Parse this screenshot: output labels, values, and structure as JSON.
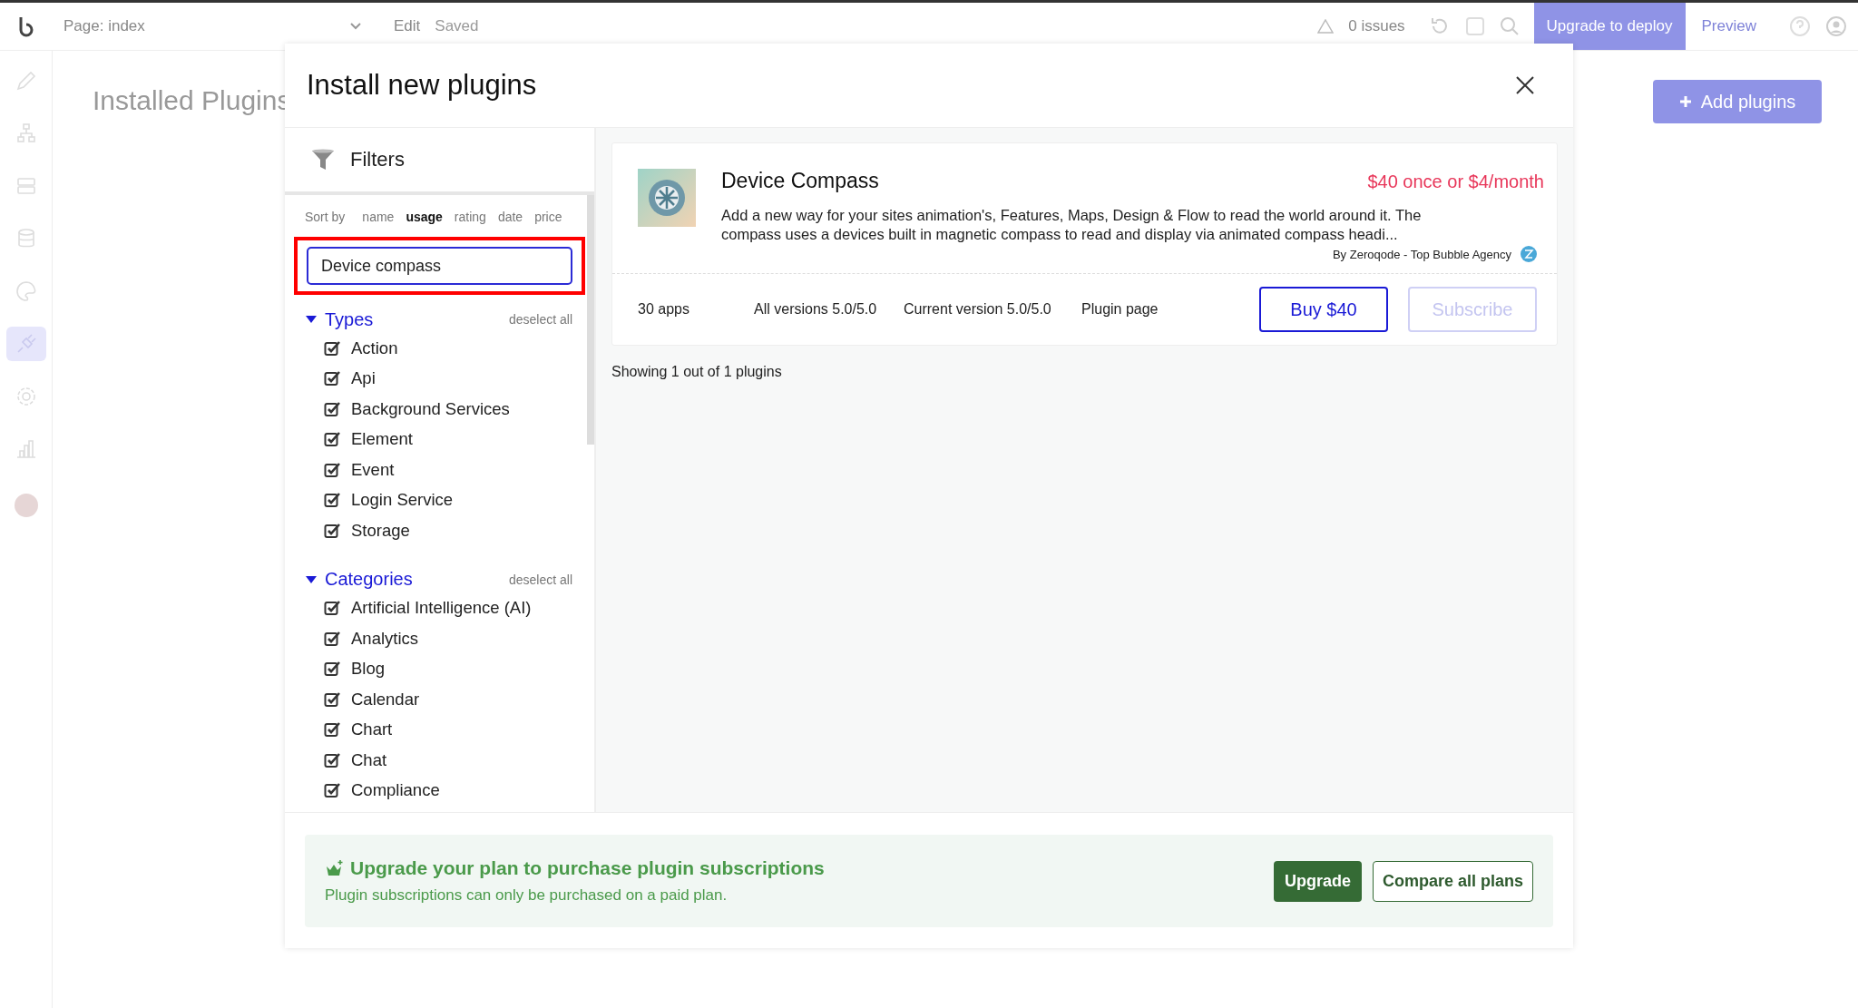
{
  "top_bar": {
    "page_selector": "Page: index",
    "edit": "Edit",
    "saved": "Saved",
    "issues": "0 issues",
    "upgrade_button": "Upgrade to deploy",
    "preview": "Preview"
  },
  "sidebar": {
    "items": [
      {
        "selected": false
      },
      {
        "selected": false
      },
      {
        "selected": false
      },
      {
        "selected": false
      },
      {
        "selected": false
      },
      {
        "selected": true
      },
      {
        "selected": false
      },
      {
        "selected": false
      }
    ]
  },
  "page": {
    "title": "Installed Plugins",
    "add_button": "Add plugins"
  },
  "modal": {
    "title": "Install new plugins",
    "filters": {
      "title": "Filters",
      "sort_label": "Sort by",
      "sort_options": [
        {
          "label": "name",
          "selected": false
        },
        {
          "label": "usage",
          "selected": true
        },
        {
          "label": "rating",
          "selected": false
        },
        {
          "label": "date",
          "selected": false
        },
        {
          "label": "price",
          "selected": false
        }
      ],
      "search": {
        "value": "Device compass",
        "highlighted": true
      },
      "groups": [
        {
          "title": "Types",
          "expanded": true,
          "deselect": "deselect all",
          "options": [
            {
              "label": "Action",
              "checked": true
            },
            {
              "label": "Api",
              "checked": true
            },
            {
              "label": "Background Services",
              "checked": true
            },
            {
              "label": "Element",
              "checked": true
            },
            {
              "label": "Event",
              "checked": true
            },
            {
              "label": "Login Service",
              "checked": true
            },
            {
              "label": "Storage",
              "checked": true
            }
          ]
        },
        {
          "title": "Categories",
          "expanded": true,
          "deselect": "deselect all",
          "options": [
            {
              "label": "Artificial Intelligence (AI)",
              "checked": true
            },
            {
              "label": "Analytics",
              "checked": true
            },
            {
              "label": "Blog",
              "checked": true
            },
            {
              "label": "Calendar",
              "checked": true
            },
            {
              "label": "Chart",
              "checked": true
            },
            {
              "label": "Chat",
              "checked": true
            },
            {
              "label": "Compliance",
              "checked": true
            }
          ]
        }
      ]
    },
    "results": {
      "plugins": [
        {
          "name": "Device Compass",
          "price": "$40 once or $4/month",
          "description": "Add a new way for your sites animation's, Features, Maps, Design & Flow to read the world around it. The compass uses a devices built in magnetic compass to read and display via animated compass headi...",
          "author": "By Zeroqode - Top Bubble Agency",
          "apps": "30 apps",
          "all_versions": "All versions 5.0/5.0",
          "current_version": "Current version 5.0/5.0",
          "link": "Plugin page",
          "buy_button": "Buy $40",
          "subscribe": {
            "label": "Subscribe",
            "disabled": true
          }
        }
      ],
      "summary": "Showing 1 out of 1 plugins"
    },
    "upgrade_banner": {
      "title": "Upgrade your plan to purchase plugin subscriptions",
      "subtitle": "Plugin subscriptions can only be purchased on a paid plan.",
      "upgrade_button": "Upgrade",
      "compare_button": "Compare all plans"
    }
  }
}
